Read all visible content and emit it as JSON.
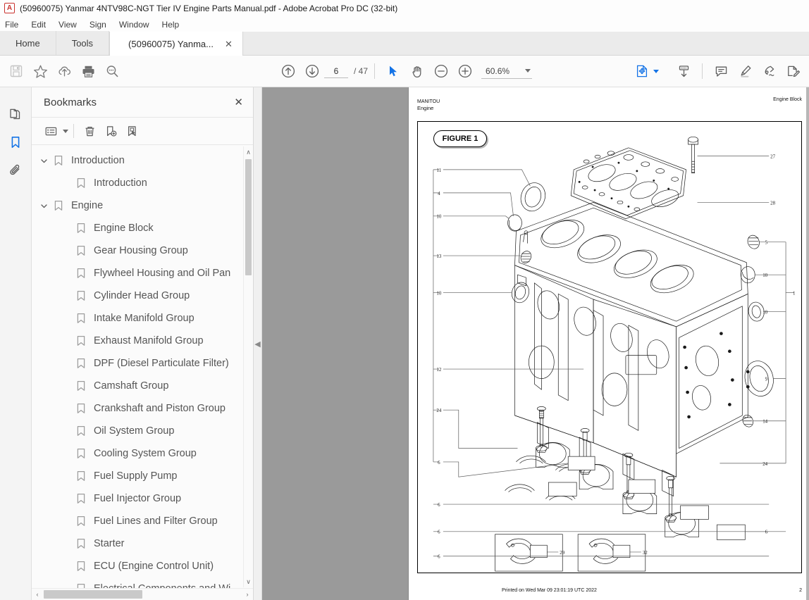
{
  "window": {
    "title": "(50960075) Yanmar 4NTV98C-NGT Tier IV Engine Parts Manual.pdf - Adobe Acrobat Pro DC (32-bit)",
    "logo_glyph": "A"
  },
  "menubar": {
    "items": [
      {
        "label": "File"
      },
      {
        "label": "Edit"
      },
      {
        "label": "View"
      },
      {
        "label": "Sign"
      },
      {
        "label": "Window"
      },
      {
        "label": "Help"
      }
    ]
  },
  "tabs": [
    {
      "label": "Home",
      "active": false
    },
    {
      "label": "Tools",
      "active": false
    },
    {
      "label": "(50960075) Yanma...",
      "active": true,
      "close_glyph": "✕"
    }
  ],
  "toolbar": {
    "save_label": "Save",
    "star_label": "Add to favorites",
    "cloud_label": "Save to cloud",
    "print_label": "Print file",
    "search_label": "Find",
    "prev_page_label": "Previous page",
    "next_page_label": "Next page",
    "page_current": "6",
    "page_total": "/ 47",
    "select_label": "Select tool",
    "hand_label": "Hand tool",
    "zoom_out_label": "Zoom out",
    "zoom_in_label": "Zoom in",
    "zoom_value": "60.6%",
    "fit_label": "Fit page",
    "scroll_label": "Scroll mode",
    "comment_label": "Add comment",
    "highlight_label": "Highlight text",
    "sign_label": "Sign",
    "edit_pdf_label": "Edit PDF"
  },
  "rail": {
    "items": [
      {
        "name": "page-thumbnails",
        "active": false
      },
      {
        "name": "bookmarks",
        "active": true
      },
      {
        "name": "attachments",
        "active": false
      }
    ]
  },
  "panel": {
    "title": "Bookmarks",
    "close_glyph": "✕",
    "toolbar": {
      "options_label": "Options",
      "delete_label": "Delete bookmark",
      "new_label": "New bookmark",
      "find_label": "Find bookmark"
    },
    "bookmarks": [
      {
        "label": "Introduction",
        "level": 0,
        "expanded": true
      },
      {
        "label": "Introduction",
        "level": 1,
        "expanded": null
      },
      {
        "label": "Engine",
        "level": 0,
        "expanded": true
      },
      {
        "label": "Engine Block",
        "level": 1,
        "expanded": null
      },
      {
        "label": "Gear Housing Group",
        "level": 1,
        "expanded": null
      },
      {
        "label": "Flywheel Housing and Oil Pan",
        "level": 1,
        "expanded": null
      },
      {
        "label": "Cylinder Head Group",
        "level": 1,
        "expanded": null
      },
      {
        "label": "Intake Manifold Group",
        "level": 1,
        "expanded": null
      },
      {
        "label": "Exhaust Manifold Group",
        "level": 1,
        "expanded": null
      },
      {
        "label": "DPF (Diesel Particulate Filter)",
        "level": 1,
        "expanded": null
      },
      {
        "label": "Camshaft Group",
        "level": 1,
        "expanded": null
      },
      {
        "label": "Crankshaft and Piston Group",
        "level": 1,
        "expanded": null
      },
      {
        "label": "Oil System Group",
        "level": 1,
        "expanded": null
      },
      {
        "label": "Cooling System Group",
        "level": 1,
        "expanded": null
      },
      {
        "label": "Fuel Supply Pump",
        "level": 1,
        "expanded": null
      },
      {
        "label": "Fuel Injector Group",
        "level": 1,
        "expanded": null
      },
      {
        "label": "Fuel Lines and Filter Group",
        "level": 1,
        "expanded": null
      },
      {
        "label": "Starter",
        "level": 1,
        "expanded": null
      },
      {
        "label": "ECU (Engine Control Unit)",
        "level": 1,
        "expanded": null
      },
      {
        "label": "Electrical Components and Wi...",
        "level": 1,
        "expanded": null
      }
    ],
    "scroll": {
      "up_glyph": "∧",
      "down_glyph": "∨",
      "left_glyph": "‹",
      "right_glyph": "›"
    }
  },
  "splitter": {
    "collapse_glyph": "◀"
  },
  "document": {
    "header_company": "MANITOU",
    "header_section": "Engine",
    "header_right": "Engine Block",
    "figure_label": "FIGURE 1",
    "footer_printed": "Printed on  Wed Mar 09 23:01:19 UTC 2022",
    "footer_page": "2",
    "callouts_left": [
      "11",
      "4",
      "10",
      "13",
      "10",
      "12",
      "24",
      "6",
      "6",
      "6",
      "6"
    ],
    "callouts_right": [
      "27",
      "28",
      "5",
      "10",
      "10",
      "9",
      "14",
      "24",
      "1",
      "6"
    ],
    "callouts_detail": [
      "29",
      "32"
    ]
  },
  "colors": {
    "accent": "#1473e6",
    "titlebar": "#fdfdfd",
    "tab_inactive": "#ebebeb",
    "panel_bg": "#fbfbfb",
    "viewer_bg": "#9a9a9a",
    "logo_red": "#c9322e"
  }
}
